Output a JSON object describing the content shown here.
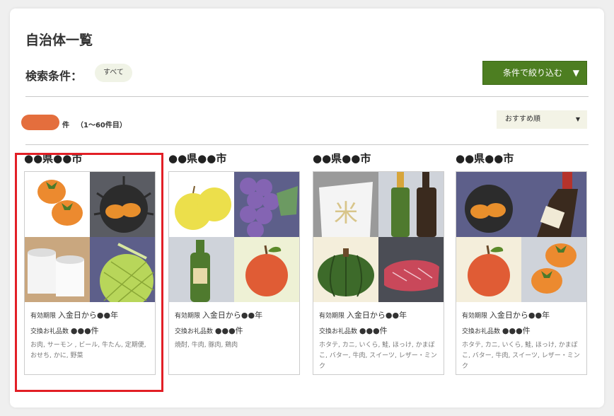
{
  "page": {
    "title": "自治体一覧"
  },
  "search": {
    "label": "検索条件：",
    "chip": "すべて",
    "filter_button": "条件で絞り込む",
    "filter_arrow": "▼"
  },
  "results": {
    "count_suffix": "件",
    "range": "（1〜60件目）",
    "pill_color": "#e46e3d"
  },
  "sort": {
    "selected": "おすすめ順",
    "arrow": "▼"
  },
  "cards": [
    {
      "name": "●●県●●市",
      "expiry_label": "有効期限",
      "expiry_value": "入金日から●●年",
      "exchange_label": "交換お礼品数",
      "exchange_value": "●●●件",
      "items": "お肉, サーモン , ビール, 牛たん, 定期便, おせち, かに, 野菜",
      "images": [
        "persimmons",
        "sea-urchin",
        "toilet-paper",
        "melon"
      ]
    },
    {
      "name": "●●県●●市",
      "expiry_label": "有効期限",
      "expiry_value": "入金日から●●年",
      "exchange_label": "交換お礼品数",
      "exchange_value": "●●●件",
      "items": "焼酎, 牛肉, 豚肉, 鶏肉",
      "images": [
        "pears",
        "grapes",
        "wine-bottle",
        "apple"
      ]
    },
    {
      "name": "●●県●●市",
      "expiry_label": "有効期限",
      "expiry_value": "入金日から●●年",
      "exchange_label": "交換お礼品数",
      "exchange_value": "●●●件",
      "items": "ホタテ, カニ, いくら, 鮭, ほっけ, かまぼこ, バター, 牛肉, スイーツ, レザー・ミンク",
      "images": [
        "rice-bag",
        "bottles",
        "pumpkin",
        "beef"
      ]
    },
    {
      "name": "●●県●●市",
      "expiry_label": "有効期限",
      "expiry_value": "入金日から●●年",
      "exchange_label": "交換お礼品数",
      "exchange_value": "●●●件",
      "items": "ホタテ, カニ, いくら, 鮭, ほっけ, かまぼこ, バター, 牛肉, スイーツ, レザー・ミンク",
      "images": [
        "sea-urchin",
        "wine-bottle-dark",
        "apple",
        "persimmons"
      ]
    }
  ],
  "colors": {
    "accent_green": "#4d7e21",
    "highlight_red": "#e21f26"
  }
}
